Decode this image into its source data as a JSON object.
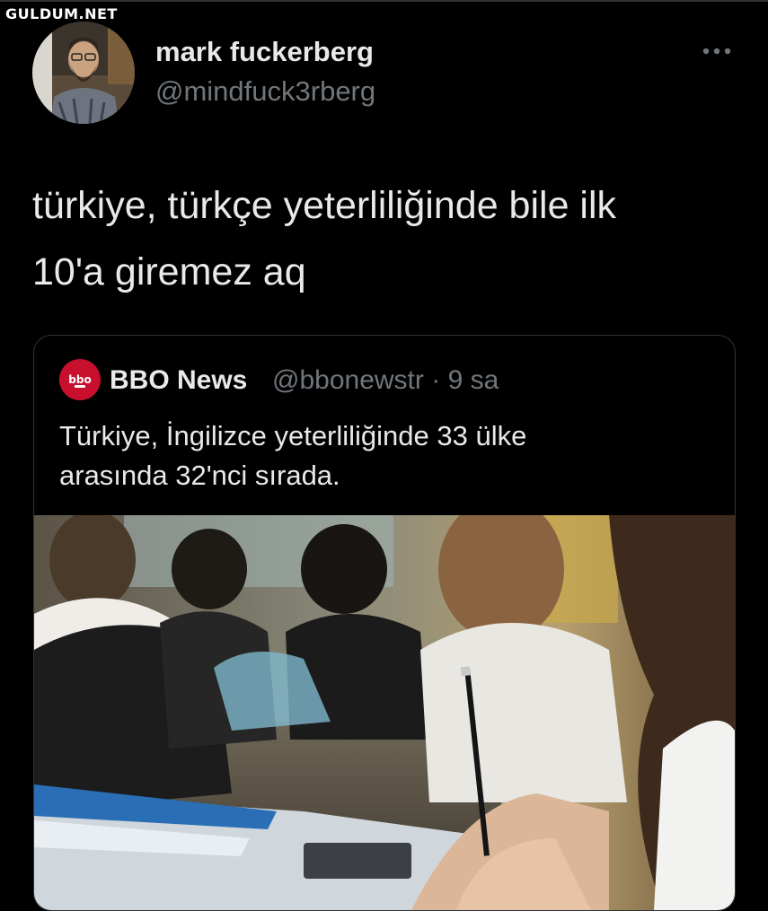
{
  "watermark": "GULDUM.NET",
  "tweet": {
    "display_name": "mark fuckerberg",
    "handle": "@mindfuck3rberg",
    "more_icon": "more-horizontal-icon",
    "text_line1": "türkiye, türkçe yeterliliğinde bile ilk",
    "text_line2": "10'a giremez aq"
  },
  "quote": {
    "logo_text": "bbo",
    "name": "BBO News",
    "handle": "@bbonewstr",
    "separator": "·",
    "time": "9 sa",
    "text_line1": "Türkiye, İngilizce yeterliliğinde 33 ülke",
    "text_line2": "arasında 32'nci sırada."
  },
  "colors": {
    "background": "#000000",
    "text": "#e7e9ea",
    "secondary": "#71767b",
    "border": "#2f3336",
    "bbo_red": "#c8102e"
  }
}
